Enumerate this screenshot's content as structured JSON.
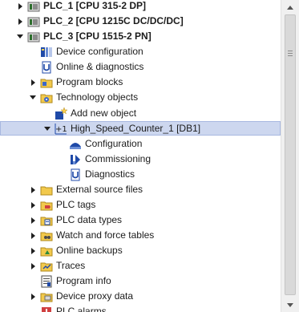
{
  "tree": {
    "items": [
      {
        "label": "PLC_1 [CPU 315-2 DP]",
        "icon": "plc-device-icon",
        "state": "collapsed",
        "bold": true
      },
      {
        "label": "PLC_2 [CPU 1215C DC/DC/DC]",
        "icon": "plc-device-icon",
        "state": "collapsed",
        "bold": true
      },
      {
        "label": "PLC_3 [CPU 1515-2 PN]",
        "icon": "plc-device-icon",
        "state": "expanded",
        "bold": true
      },
      {
        "label": "Device configuration",
        "icon": "device-configuration-icon",
        "state": "leaf"
      },
      {
        "label": "Online & diagnostics",
        "icon": "online-diagnostics-icon",
        "state": "leaf"
      },
      {
        "label": "Program blocks",
        "icon": "folder-icon",
        "state": "collapsed"
      },
      {
        "label": "Technology objects",
        "icon": "technology-folder-icon",
        "state": "expanded"
      },
      {
        "label": "Add new object",
        "icon": "add-new-object-icon",
        "state": "leaf"
      },
      {
        "label": "High_Speed_Counter_1 [DB1]",
        "icon": "counter-object-icon",
        "state": "expanded",
        "selected": true
      },
      {
        "label": "Configuration",
        "icon": "configuration-icon",
        "state": "leaf"
      },
      {
        "label": "Commissioning",
        "icon": "commissioning-icon",
        "state": "leaf"
      },
      {
        "label": "Diagnostics",
        "icon": "diagnostics-icon",
        "state": "leaf"
      },
      {
        "label": "External source files",
        "icon": "folder-icon",
        "state": "collapsed"
      },
      {
        "label": "PLC tags",
        "icon": "plc-tags-folder-icon",
        "state": "collapsed"
      },
      {
        "label": "PLC data types",
        "icon": "plc-data-types-folder-icon",
        "state": "collapsed"
      },
      {
        "label": "Watch and force tables",
        "icon": "watch-tables-folder-icon",
        "state": "collapsed"
      },
      {
        "label": "Online backups",
        "icon": "online-backups-folder-icon",
        "state": "collapsed"
      },
      {
        "label": "Traces",
        "icon": "traces-folder-icon",
        "state": "collapsed"
      },
      {
        "label": "Program info",
        "icon": "program-info-icon",
        "state": "leaf"
      },
      {
        "label": "Device proxy data",
        "icon": "device-proxy-folder-icon",
        "state": "collapsed"
      },
      {
        "label": "PLC alarms",
        "icon": "plc-alarms-icon",
        "state": "leaf"
      }
    ]
  },
  "colors": {
    "selection_bg": "#cdd7ef",
    "folder": "#f2c94c",
    "icon_blue": "#1f4aa8"
  }
}
